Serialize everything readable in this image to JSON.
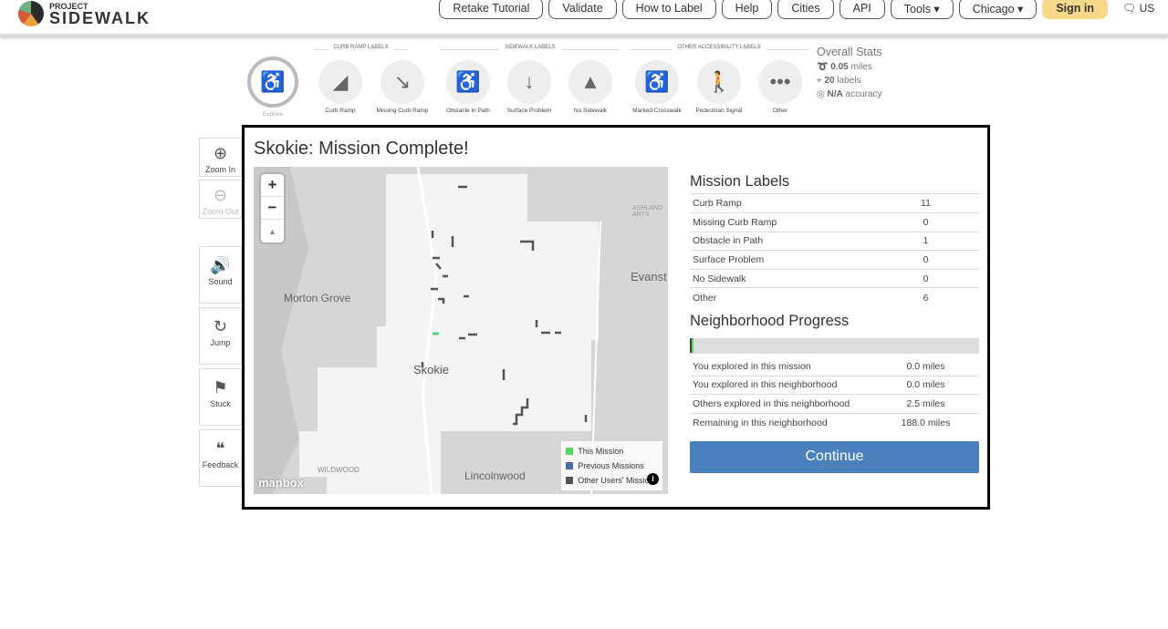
{
  "header": {
    "logo_small": "PROJECT",
    "logo_big": "SIDEWALK",
    "nav": [
      "Retake Tutorial",
      "Validate",
      "How to Label",
      "Help",
      "Cities",
      "API",
      "Tools ▾",
      "Chicago ▾"
    ],
    "sign_in": "Sign in",
    "language": "US"
  },
  "label_groups": [
    "CURB RAMP LABELS",
    "SIDEWALK LABELS",
    "OTHER ACCESSIBILITY LABELS"
  ],
  "label_buttons": [
    {
      "label": "Explore",
      "icon": "♿"
    },
    {
      "label": "Curb Ramp",
      "icon": "◢"
    },
    {
      "label": "Missing Curb Ramp",
      "icon": "↘"
    },
    {
      "label": "Obstacle in Path",
      "icon": "♿"
    },
    {
      "label": "Surface Problem",
      "icon": "↓"
    },
    {
      "label": "No Sidewalk",
      "icon": "▲"
    },
    {
      "label": "Marked Crosswalk",
      "icon": "♿"
    },
    {
      "label": "Pedestrian Signal",
      "icon": "🚶"
    },
    {
      "label": "Other",
      "icon": "•••"
    }
  ],
  "overall_stats": {
    "title": "Overall Stats",
    "miles": "0.05",
    "miles_unit": "miles",
    "labels": "20",
    "labels_unit": "labels",
    "accuracy": "N/A",
    "accuracy_unit": "accuracy"
  },
  "tools": [
    {
      "label": "Zoom In",
      "icon": "⊕"
    },
    {
      "label": "Zoom Out",
      "icon": "⊖"
    },
    {
      "label": "Sound",
      "icon": "🔊"
    },
    {
      "label": "Jump",
      "icon": "↻"
    },
    {
      "label": "Stuck",
      "icon": "⚑"
    },
    {
      "label": "Feedback",
      "icon": "❝"
    }
  ],
  "modal": {
    "title": "Skokie: Mission Complete!",
    "map": {
      "zoom_in": "+",
      "zoom_out": "−",
      "compass": "▲",
      "places": [
        "Morton Grove",
        "Skokie",
        "Evanst",
        "Lincolnwood",
        "WILDWOOD",
        "ASHLAND ARTS"
      ],
      "attribution": "mapbox",
      "info": "i",
      "legend": [
        {
          "label": "This Mission",
          "color": "#5bd36a"
        },
        {
          "label": "Previous Missions",
          "color": "#4a6fa5"
        },
        {
          "label": "Other Users' Missions",
          "color": "#555555"
        }
      ]
    },
    "mission_labels_title": "Mission Labels",
    "mission_labels": [
      {
        "label": "Curb Ramp",
        "count": "11"
      },
      {
        "label": "Missing Curb Ramp",
        "count": "0"
      },
      {
        "label": "Obstacle in Path",
        "count": "1"
      },
      {
        "label": "Surface Problem",
        "count": "0"
      },
      {
        "label": "No Sidewalk",
        "count": "0"
      },
      {
        "label": "Other",
        "count": "6"
      }
    ],
    "progress_title": "Neighborhood Progress",
    "progress_fraction": 0.013,
    "progress_rows": [
      {
        "label": "You explored in this mission",
        "value": "0.0 miles"
      },
      {
        "label": "You explored in this neighborhood",
        "value": "0.0 miles"
      },
      {
        "label": "Others explored in this neighborhood",
        "value": "2.5 miles"
      },
      {
        "label": "Remaining in this neighborhood",
        "value": "188.0 miles"
      }
    ],
    "continue": "Continue"
  }
}
